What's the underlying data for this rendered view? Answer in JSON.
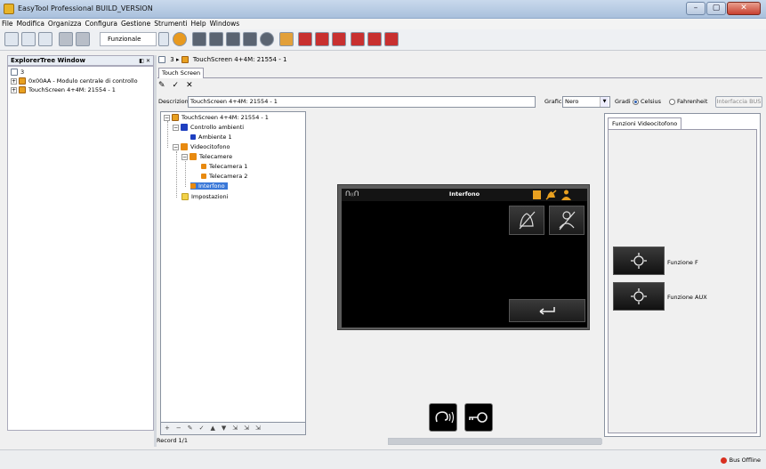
{
  "window": {
    "title": "EasyTool Professional BUILD_VERSION"
  },
  "menu": [
    "File",
    "Modifica",
    "Organizza",
    "Configura",
    "Gestione",
    "Strumenti",
    "Help",
    "Windows"
  ],
  "toolbar": {
    "mode": "Funzionale"
  },
  "explorer": {
    "title": "ExplorerTree Window",
    "close": "◧ ✕",
    "items": [
      {
        "label": "3"
      },
      {
        "label": "0x00AA - Modulo centrale di controllo"
      },
      {
        "label": "TouchScreen 4+4M: 21554 - 1"
      }
    ]
  },
  "breadcrumb": {
    "root": "3",
    "sep": "▸",
    "item": "TouchScreen 4+4M: 21554 - 1"
  },
  "tabs": [
    "Touch Screen"
  ],
  "edit_tools": [
    "✎",
    "✓",
    "✕"
  ],
  "form": {
    "descr_label": "Descrizione",
    "descr_value": "TouchScreen 4+4M: 21554 - 1",
    "grafica_label": "Grafica",
    "grafica_value": "Nero",
    "gradi_label": "Gradi",
    "celsius": "Celsius",
    "fahrenheit": "Fahrenheit",
    "bus_button": "Interfaccia BUS"
  },
  "tree": [
    {
      "label": "TouchScreen 4+4M: 21554 - 1"
    },
    {
      "label": "Controllo ambienti"
    },
    {
      "label": "Ambiente 1"
    },
    {
      "label": "Videocitofono"
    },
    {
      "label": "Telecamere"
    },
    {
      "label": "Telecamera 1"
    },
    {
      "label": "Telecamera 2"
    },
    {
      "label": "Interfono"
    },
    {
      "label": "Impostazioni"
    }
  ],
  "tree_tools": [
    "+",
    "−",
    "✎",
    "✓",
    "▲",
    "▼",
    "⇲",
    "⇲",
    "⇲"
  ],
  "record": "Record 1/1",
  "device": {
    "title": "Interfono",
    "head_glyph": "ᑎ₍₍ᑎ"
  },
  "right_panel": {
    "tab": "Funzioni Videocitofono",
    "funcs": [
      "Funzione F",
      "Funzione AUX"
    ]
  },
  "status": {
    "bus": "Bus Offline"
  },
  "colors": {
    "accent": "#e88a10",
    "selection": "#3a78d8"
  }
}
